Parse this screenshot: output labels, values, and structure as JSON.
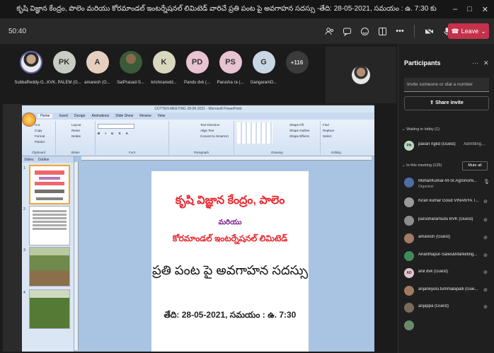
{
  "window": {
    "title": "కృషి విజ్ఞాన కేంద్రం, పొలెం మరియు కోరమాండల్ ఇంటర్నేషనల్ లిమిటెడ్ వారిచే ప్రతి పంట పై అవగాహన సదస్సు -తేది: 28-05-2021, సమయం : ఉ. 7:30 కు",
    "minimize": "–",
    "maximize": "□",
    "close": "✕"
  },
  "toolbar": {
    "timer": "50:40",
    "leave_label": "Leave",
    "icons": [
      "participants-icon",
      "chat-icon",
      "reactions-icon",
      "rooms-icon",
      "more-icon",
      "camera-icon",
      "mic-icon",
      "share-icon"
    ]
  },
  "avatars": [
    {
      "initials": "",
      "name": "SubbaReddy-G..."
    },
    {
      "initials": "PK",
      "name": "KVK, PALEM (G..."
    },
    {
      "initials": "A",
      "name": "amaresh (G..."
    },
    {
      "initials": "",
      "name": "SaiPrasad-S..."
    },
    {
      "initials": "K",
      "name": "krishnaredd..."
    },
    {
      "initials": "PD",
      "name": "Pandu dvk (..."
    },
    {
      "initials": "PS",
      "name": "Parusha ra (..."
    },
    {
      "initials": "G",
      "name": "GangaramD..."
    },
    {
      "initials": "+116",
      "name": ""
    }
  ],
  "ppt": {
    "title": "COTTEN MEETING 28-05-2021 - Microsoft PowerPoint",
    "tabs": [
      "Home",
      "Insert",
      "Design",
      "Animations",
      "Slide Show",
      "Review",
      "View"
    ],
    "groups": [
      "Clipboard",
      "Slides",
      "Font",
      "Paragraph",
      "Drawing",
      "Editing"
    ],
    "clipboard_items": [
      "Cut",
      "Copy",
      "Format Painter"
    ],
    "slides_items": [
      "Layout",
      "Reset",
      "Delete"
    ],
    "paragraph_items": [
      "Text Direction",
      "Align Text",
      "Convert to SmartArt"
    ],
    "drawing_items": [
      "Shape Fill",
      "Shape Outline",
      "Shape Effects"
    ],
    "editing_items": [
      "Find",
      "Replace",
      "Select"
    ],
    "pane_tabs": [
      "Slides",
      "Outline"
    ],
    "thumb_nums": [
      "1",
      "2",
      "3",
      "4"
    ]
  },
  "slide": {
    "line1": "కృషి విజ్ఞాన కేంద్రం, పాలెం",
    "line2": "మరియు",
    "line3": "కోరమాండల్ ఇంటర్నేషనల్ లిమిటెడ్",
    "line4": "ప్రతి పంట పై అవగాహన సదస్సు",
    "line5": "తేది: 28-05-2021, సమయం : ఉ. 7:30"
  },
  "participants": {
    "title": "Participants",
    "invite_placeholder": "Invite someone or dial a number",
    "share_invite": "Share invite",
    "lobby_header": "Waiting in lobby (1)",
    "lobby": [
      {
        "initials": "PN",
        "name": "pavan ngkd (Guest)",
        "status": "Admitting..."
      }
    ],
    "meeting_header": "In this meeting (125)",
    "mute_all": "Mute all",
    "people": [
      {
        "initials": "",
        "name": "MohanKumar-M-Sr.Agronomi...",
        "sub": "Organizer"
      },
      {
        "initials": "",
        "name": "Kiran kumar Goud VINANYA T...",
        "sub": ""
      },
      {
        "initials": "",
        "name": "parusharamudu BVK (Guest)",
        "sub": ""
      },
      {
        "initials": "",
        "name": "amaresh (Guest)",
        "sub": ""
      },
      {
        "initials": "",
        "name": "Ananthapur-Sales&Marketing...",
        "sub": ""
      },
      {
        "initials": "AD",
        "name": "anil dvk (Guest)",
        "sub": ""
      },
      {
        "initials": "",
        "name": "anjaneyulu.tummalapalli (Gue...",
        "sub": ""
      },
      {
        "initials": "",
        "name": "anjappa (Guest)",
        "sub": ""
      }
    ]
  }
}
